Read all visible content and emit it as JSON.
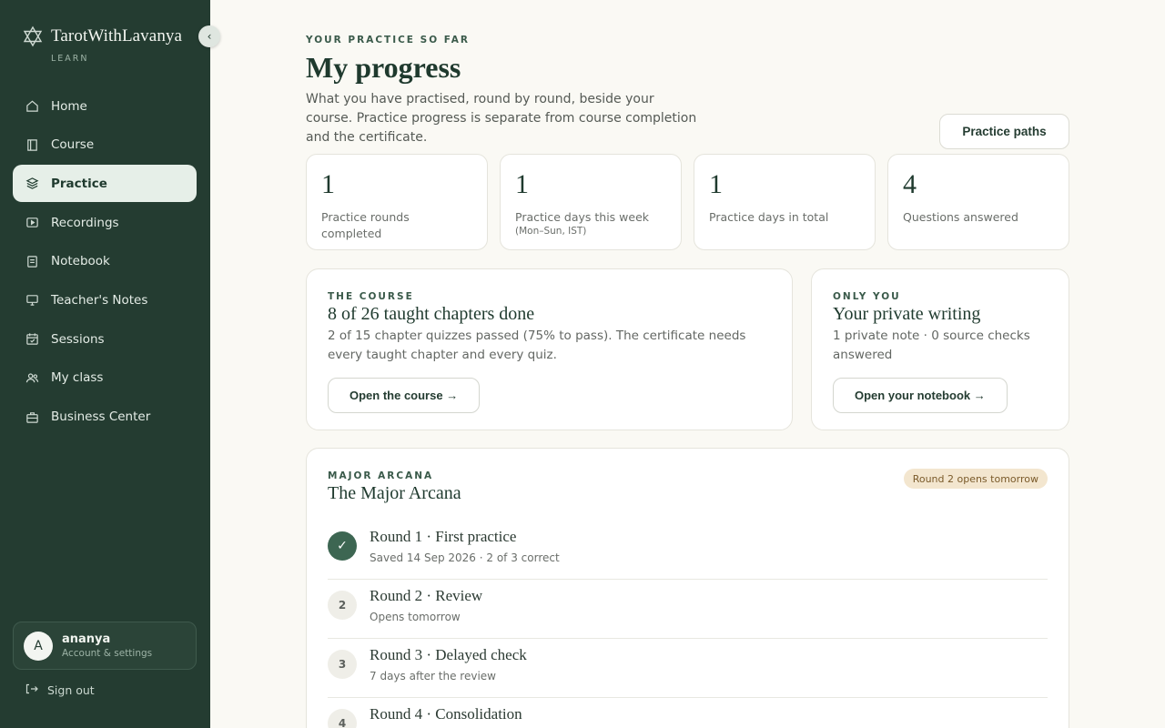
{
  "brand": {
    "name": "TarotWithLavanya",
    "sub": "LEARN"
  },
  "nav": [
    {
      "label": "Home",
      "icon": "home-icon",
      "active": false
    },
    {
      "label": "Course",
      "icon": "book-icon",
      "active": false
    },
    {
      "label": "Practice",
      "icon": "layers-icon",
      "active": true
    },
    {
      "label": "Recordings",
      "icon": "play-icon",
      "active": false
    },
    {
      "label": "Notebook",
      "icon": "notebook-icon",
      "active": false
    },
    {
      "label": "Teacher's Notes",
      "icon": "monitor-icon",
      "active": false
    },
    {
      "label": "Sessions",
      "icon": "calendar-icon",
      "active": false
    },
    {
      "label": "My class",
      "icon": "users-icon",
      "active": false
    },
    {
      "label": "Business Center",
      "icon": "briefcase-icon",
      "active": false
    }
  ],
  "account": {
    "initial": "A",
    "name": "ananya",
    "sub": "Account & settings"
  },
  "signout": "Sign out",
  "header": {
    "eyebrow": "YOUR PRACTICE SO FAR",
    "title": "My progress",
    "description": "What you have practised, round by round, beside your course. Practice progress is separate from course completion and the certificate.",
    "paths_button": "Practice paths"
  },
  "stats": [
    {
      "value": "1",
      "label": "Practice rounds completed",
      "sub": ""
    },
    {
      "value": "1",
      "label": "Practice days this week",
      "sub": "(Mon–Sun, IST)"
    },
    {
      "value": "1",
      "label": "Practice days in total",
      "sub": ""
    },
    {
      "value": "4",
      "label": "Questions answered",
      "sub": ""
    }
  ],
  "course_card": {
    "eyebrow": "THE COURSE",
    "title": "8 of 26 taught chapters done",
    "description": "2 of 15 chapter quizzes passed (75% to pass). The certificate needs every taught chapter and every quiz.",
    "button": "Open the course →"
  },
  "writing_card": {
    "eyebrow": "ONLY YOU",
    "title": "Your private writing",
    "description": "1 private note · 0 source checks answered",
    "button": "Open your notebook →"
  },
  "arcana": {
    "eyebrow": "MAJOR ARCANA",
    "title": "The Major Arcana",
    "badge": "Round 2 opens tomorrow",
    "rounds": [
      {
        "marker": "✓",
        "done": true,
        "title": "Round 1 · First practice",
        "sub": "Saved 14 Sep 2026 · 2 of 3 correct"
      },
      {
        "marker": "2",
        "done": false,
        "title": "Round 2 · Review",
        "sub": "Opens tomorrow"
      },
      {
        "marker": "3",
        "done": false,
        "title": "Round 3 · Delayed check",
        "sub": "7 days after the review"
      },
      {
        "marker": "4",
        "done": false,
        "title": "Round 4 · Consolidation",
        "sub": ""
      }
    ]
  },
  "colors": {
    "sidebar": "#243c31",
    "accent": "#3d6652",
    "background": "#faf9f4",
    "badge": "#f3e6cf"
  }
}
